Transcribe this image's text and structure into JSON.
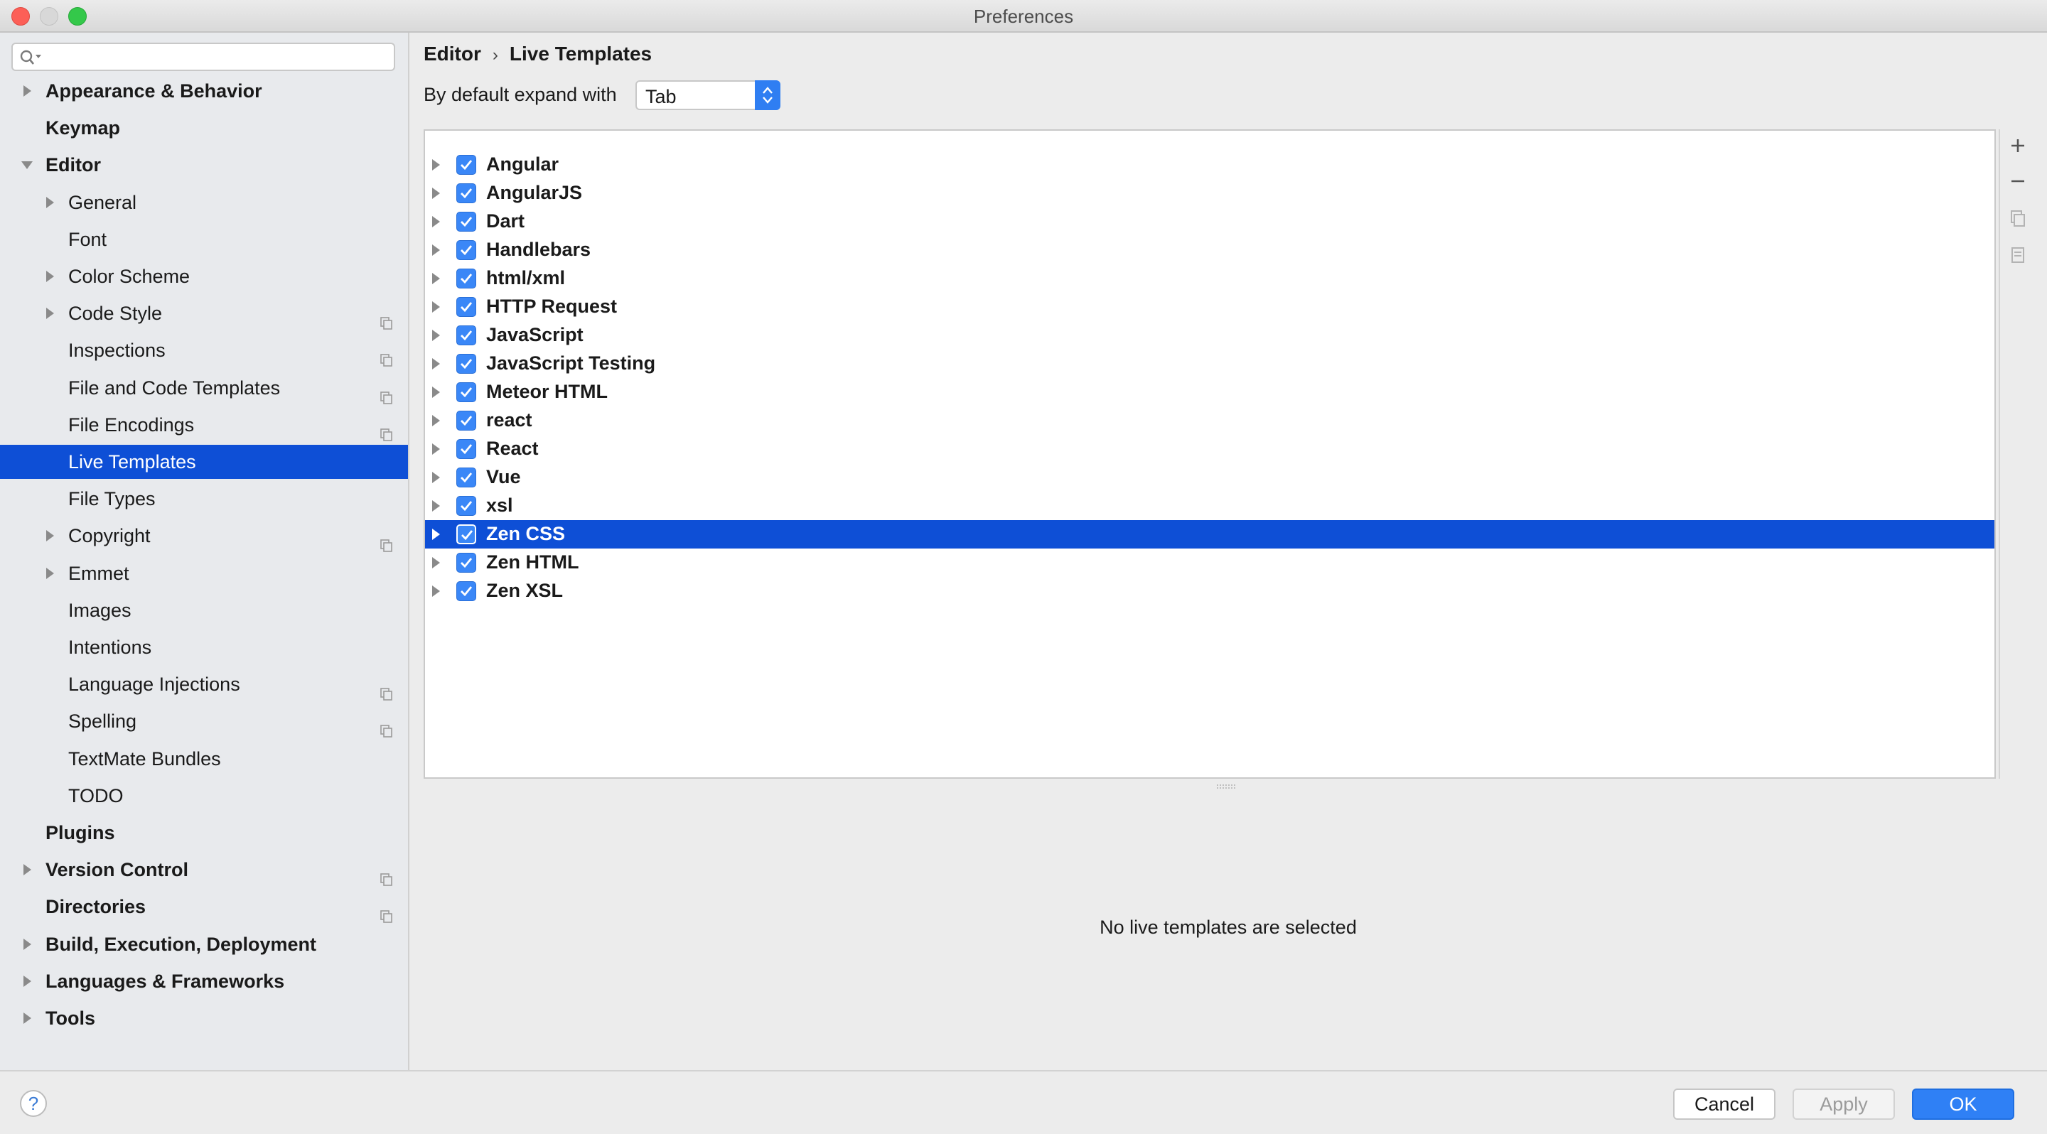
{
  "window": {
    "title": "Preferences"
  },
  "search": {
    "placeholder": ""
  },
  "sidebar": {
    "items": [
      {
        "label": "Appearance & Behavior",
        "level": 0,
        "bold": true,
        "arrow": "right",
        "copy": false,
        "selected": false
      },
      {
        "label": "Keymap",
        "level": 0,
        "bold": true,
        "arrow": "none",
        "copy": false,
        "selected": false
      },
      {
        "label": "Editor",
        "level": 0,
        "bold": true,
        "arrow": "down",
        "copy": false,
        "selected": false
      },
      {
        "label": "General",
        "level": 1,
        "bold": false,
        "arrow": "right",
        "copy": false,
        "selected": false
      },
      {
        "label": "Font",
        "level": 1,
        "bold": false,
        "arrow": "none",
        "copy": false,
        "selected": false
      },
      {
        "label": "Color Scheme",
        "level": 1,
        "bold": false,
        "arrow": "right",
        "copy": false,
        "selected": false
      },
      {
        "label": "Code Style",
        "level": 1,
        "bold": false,
        "arrow": "right",
        "copy": true,
        "selected": false
      },
      {
        "label": "Inspections",
        "level": 1,
        "bold": false,
        "arrow": "none",
        "copy": true,
        "selected": false
      },
      {
        "label": "File and Code Templates",
        "level": 1,
        "bold": false,
        "arrow": "none",
        "copy": true,
        "selected": false
      },
      {
        "label": "File Encodings",
        "level": 1,
        "bold": false,
        "arrow": "none",
        "copy": true,
        "selected": false
      },
      {
        "label": "Live Templates",
        "level": 1,
        "bold": false,
        "arrow": "none",
        "copy": false,
        "selected": true
      },
      {
        "label": "File Types",
        "level": 1,
        "bold": false,
        "arrow": "none",
        "copy": false,
        "selected": false
      },
      {
        "label": "Copyright",
        "level": 1,
        "bold": false,
        "arrow": "right",
        "copy": true,
        "selected": false
      },
      {
        "label": "Emmet",
        "level": 1,
        "bold": false,
        "arrow": "right",
        "copy": false,
        "selected": false
      },
      {
        "label": "Images",
        "level": 1,
        "bold": false,
        "arrow": "none",
        "copy": false,
        "selected": false
      },
      {
        "label": "Intentions",
        "level": 1,
        "bold": false,
        "arrow": "none",
        "copy": false,
        "selected": false
      },
      {
        "label": "Language Injections",
        "level": 1,
        "bold": false,
        "arrow": "none",
        "copy": true,
        "selected": false
      },
      {
        "label": "Spelling",
        "level": 1,
        "bold": false,
        "arrow": "none",
        "copy": true,
        "selected": false
      },
      {
        "label": "TextMate Bundles",
        "level": 1,
        "bold": false,
        "arrow": "none",
        "copy": false,
        "selected": false
      },
      {
        "label": "TODO",
        "level": 1,
        "bold": false,
        "arrow": "none",
        "copy": false,
        "selected": false
      },
      {
        "label": "Plugins",
        "level": 0,
        "bold": true,
        "arrow": "none",
        "copy": false,
        "selected": false
      },
      {
        "label": "Version Control",
        "level": 0,
        "bold": true,
        "arrow": "right",
        "copy": true,
        "selected": false
      },
      {
        "label": "Directories",
        "level": 0,
        "bold": true,
        "arrow": "none",
        "copy": true,
        "selected": false
      },
      {
        "label": "Build, Execution, Deployment",
        "level": 0,
        "bold": true,
        "arrow": "right",
        "copy": false,
        "selected": false
      },
      {
        "label": "Languages & Frameworks",
        "level": 0,
        "bold": true,
        "arrow": "right",
        "copy": false,
        "selected": false
      },
      {
        "label": "Tools",
        "level": 0,
        "bold": true,
        "arrow": "right",
        "copy": false,
        "selected": false
      }
    ]
  },
  "breadcrumb": {
    "parent": "Editor",
    "separator": "›",
    "current": "Live Templates"
  },
  "expand": {
    "label": "By default expand with",
    "value": "Tab"
  },
  "templates": [
    {
      "label": "Angular",
      "checked": true,
      "selected": false
    },
    {
      "label": "AngularJS",
      "checked": true,
      "selected": false
    },
    {
      "label": "Dart",
      "checked": true,
      "selected": false
    },
    {
      "label": "Handlebars",
      "checked": true,
      "selected": false
    },
    {
      "label": "html/xml",
      "checked": true,
      "selected": false
    },
    {
      "label": "HTTP Request",
      "checked": true,
      "selected": false
    },
    {
      "label": "JavaScript",
      "checked": true,
      "selected": false
    },
    {
      "label": "JavaScript Testing",
      "checked": true,
      "selected": false
    },
    {
      "label": "Meteor HTML",
      "checked": true,
      "selected": false
    },
    {
      "label": "react",
      "checked": true,
      "selected": false
    },
    {
      "label": "React",
      "checked": true,
      "selected": false
    },
    {
      "label": "Vue",
      "checked": true,
      "selected": false
    },
    {
      "label": "xsl",
      "checked": true,
      "selected": false
    },
    {
      "label": "Zen CSS",
      "checked": true,
      "selected": true
    },
    {
      "label": "Zen HTML",
      "checked": true,
      "selected": false
    },
    {
      "label": "Zen XSL",
      "checked": true,
      "selected": false
    }
  ],
  "tools": [
    "add-icon",
    "remove-icon",
    "copy-icon",
    "restore-icon"
  ],
  "empty_message": "No live templates are selected",
  "footer": {
    "help": "?",
    "cancel": "Cancel",
    "apply": "Apply",
    "ok": "OK"
  },
  "colors": {
    "selection": "#0e4fd6",
    "accent": "#2f80f5",
    "checkbox": "#3a87f7"
  }
}
